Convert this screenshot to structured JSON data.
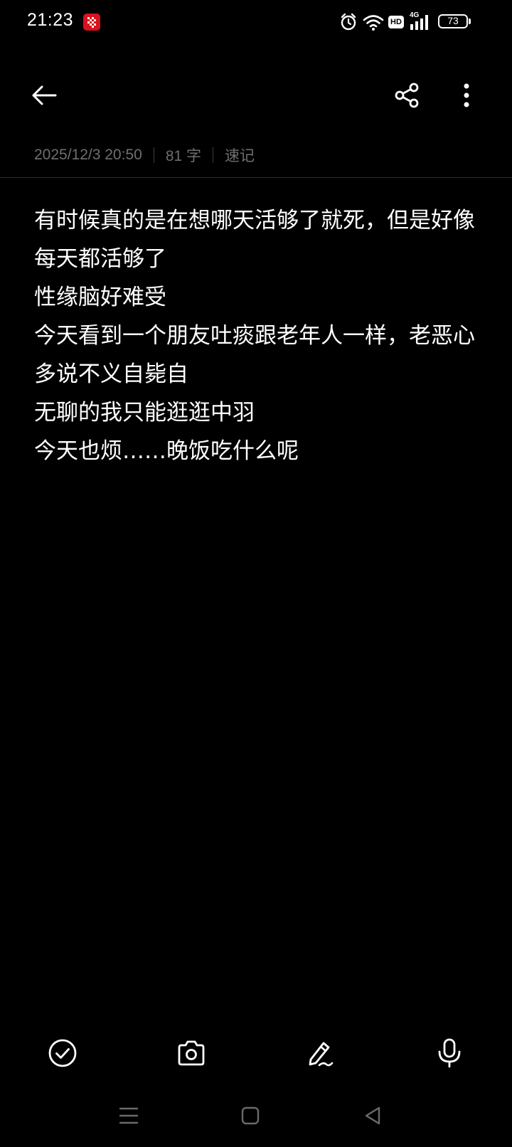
{
  "status_bar": {
    "time": "21:23",
    "network": "4G",
    "hd": "HD",
    "battery": "73",
    "icons": [
      "app-icon",
      "alarm-icon",
      "wifi-icon",
      "hd-icon",
      "signal-4g-icon",
      "battery-icon"
    ]
  },
  "header": {
    "icons": [
      "back-arrow-icon",
      "share-icon",
      "more-vertical-icon"
    ]
  },
  "meta": {
    "datetime": "2025/12/3 20:50",
    "char_count": "81 字",
    "category": "速记"
  },
  "note": {
    "lines": [
      "有时候真的是在想哪天活够了就死，但是好像每天都活够了",
      "性缘脑好难受",
      "今天看到一个朋友吐痰跟老年人一样，老恶心",
      "多说不义自毙自",
      "无聊的我只能逛逛中羽",
      "今天也烦……晚饭吃什么呢"
    ]
  },
  "toolbar": {
    "icons": [
      "checklist-icon",
      "camera-icon",
      "pen-icon",
      "microphone-icon"
    ]
  },
  "nav": {
    "icons": [
      "menu-icon",
      "home-icon",
      "back-triangle-icon"
    ]
  },
  "colors": {
    "background": "#000000",
    "text": "#ffffff",
    "meta_text": "#6f6f6f",
    "app_icon_red": "#d8121e"
  }
}
